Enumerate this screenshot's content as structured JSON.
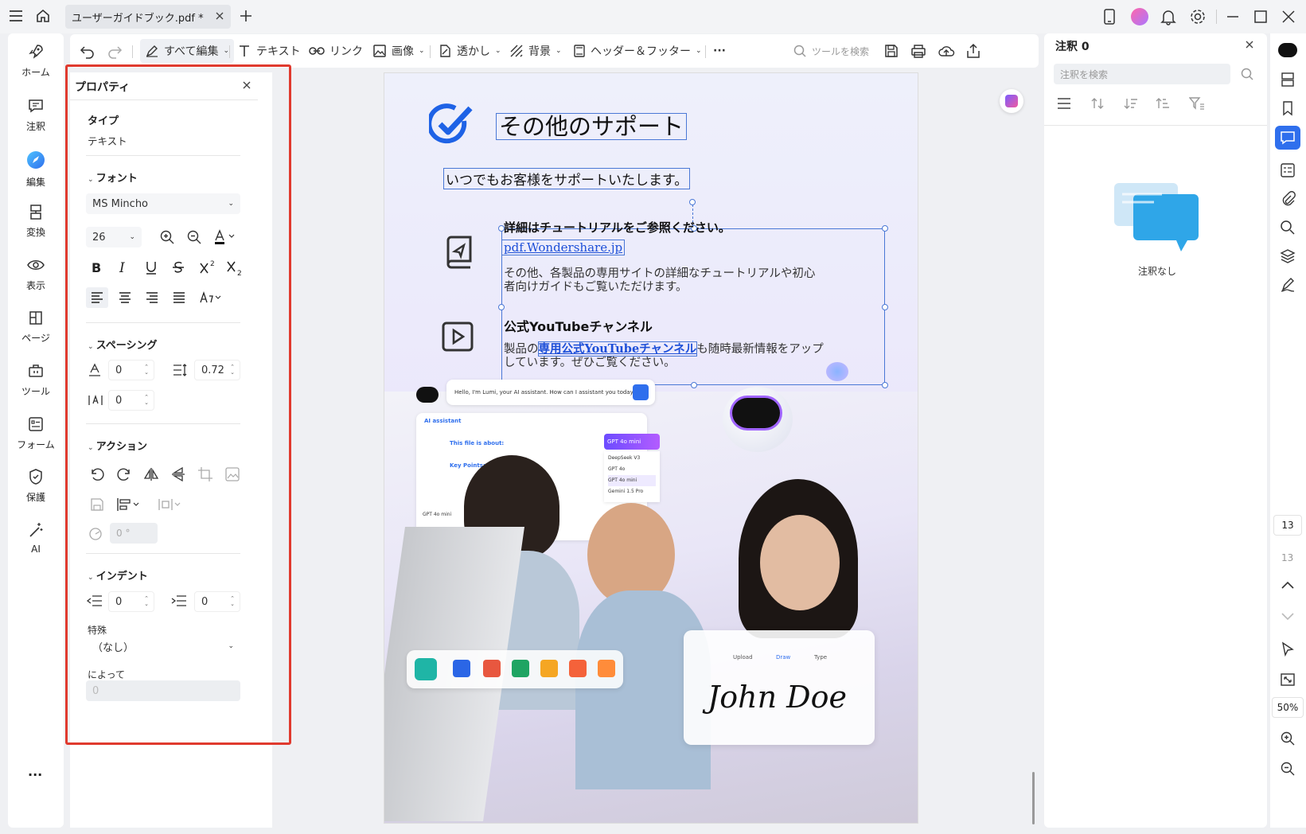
{
  "window": {
    "tab_title": "ユーザーガイドブック.pdf *"
  },
  "leftnav": {
    "items": [
      {
        "label": "ホーム",
        "icon": "rocket-icon"
      },
      {
        "label": "注釈",
        "icon": "comment-icon"
      },
      {
        "label": "編集",
        "icon": "edit-icon"
      },
      {
        "label": "変換",
        "icon": "convert-icon"
      },
      {
        "label": "表示",
        "icon": "eye-icon"
      },
      {
        "label": "ページ",
        "icon": "page-icon"
      },
      {
        "label": "ツール",
        "icon": "toolbox-icon"
      },
      {
        "label": "フォーム",
        "icon": "form-icon"
      },
      {
        "label": "保護",
        "icon": "shield-icon"
      },
      {
        "label": "AI",
        "icon": "magic-wand-icon"
      }
    ],
    "more": "..."
  },
  "toolbar": {
    "edit_all": "すべて編集",
    "text": "テキスト",
    "link": "リンク",
    "image": "画像",
    "watermark": "透かし",
    "background": "背景",
    "header_footer": "ヘッダー＆フッター",
    "more": "···",
    "search_placeholder": "ツールを検索"
  },
  "properties": {
    "title": "プロパティ",
    "type_label": "タイプ",
    "type_value": "テキスト",
    "font_section": "フォント",
    "font_name": "MS Mincho",
    "font_size": "26",
    "spacing_section": "スペーシング",
    "char_spacing": "0",
    "line_spacing": "0.72",
    "word_spacing": "0",
    "action_section": "アクション",
    "rotation": "0 °",
    "indent_section": "インデント",
    "indent_left": "0",
    "indent_right": "0",
    "special_label": "特殊",
    "special_value": "（なし）",
    "by_label": "によって",
    "by_value": "0"
  },
  "document": {
    "heading": "その他のサポート",
    "subheading": "いつでもお客様をサポートいたします。",
    "tutorial_title": "詳細はチュートリアルをご参照ください。",
    "tutorial_link": "pdf.Wondershare.jp",
    "tutorial_body_1": "その他、各製品の専用サイトの詳細なチュートリアルや初心",
    "tutorial_body_2": "者向けガイドもご覧いただけます。",
    "youtube_title": "公式YouTubeチャンネル",
    "youtube_body_pre": "製品の",
    "youtube_link": "専用公式YouTubeチャンネル",
    "youtube_body_post": "も随時最新情報をアップ",
    "youtube_body_2": "しています。ぜひご覧ください。",
    "ai_chat": "Hello, I'm Lumi, your AI assistant. How can I assistant you today?",
    "ai_panel_title": "AI assistant",
    "ai_file_about": "This file is about:",
    "ai_key_points": "Key Points:",
    "ai_model_selected": "GPT 4o mini",
    "ai_models": [
      "DeepSeek V3",
      "GPT 4o",
      "GPT 4o mini",
      "Gemini 1.5 Pro"
    ],
    "ai_chip": "GPT 4o mini",
    "sign_tabs": [
      "Upload",
      "Draw",
      "Type"
    ],
    "signature": "John Doe"
  },
  "comments": {
    "title": "注釈 0",
    "search_placeholder": "注釈を検索",
    "empty_text": "注釈なし"
  },
  "rightbar": {
    "page_current": "13",
    "page_total": "13",
    "zoom": "50%"
  },
  "colors": {
    "accent": "#2f6fed",
    "highlight_frame": "#e03a2e",
    "link": "#1d4fd8"
  }
}
